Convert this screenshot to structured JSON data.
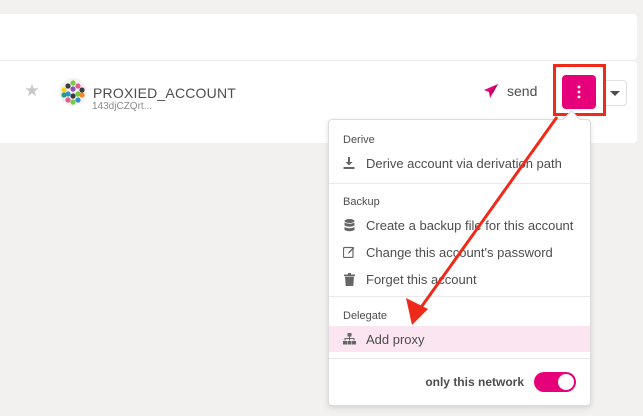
{
  "account": {
    "name": "PROXIED_ACCOUNT",
    "address_short": "143djCZQrt..."
  },
  "actions": {
    "send_label": "send"
  },
  "menu": {
    "sections": [
      {
        "header": "Derive",
        "items": [
          {
            "label": "Derive account via derivation path",
            "icon": "download-icon"
          }
        ]
      },
      {
        "header": "Backup",
        "items": [
          {
            "label": "Create a backup file for this account",
            "icon": "database-icon"
          },
          {
            "label": "Change this account's password",
            "icon": "edit-icon"
          },
          {
            "label": "Forget this account",
            "icon": "trash-icon"
          }
        ]
      },
      {
        "header": "Delegate",
        "items": [
          {
            "label": "Add proxy",
            "icon": "sitemap-icon",
            "highlighted": true
          }
        ]
      }
    ],
    "toggle": {
      "label": "only this network",
      "state": "on"
    }
  },
  "colors": {
    "accent": "#e6007a",
    "highlight_bg": "#fbe5f1",
    "annotation_red": "#ee2a1b"
  }
}
